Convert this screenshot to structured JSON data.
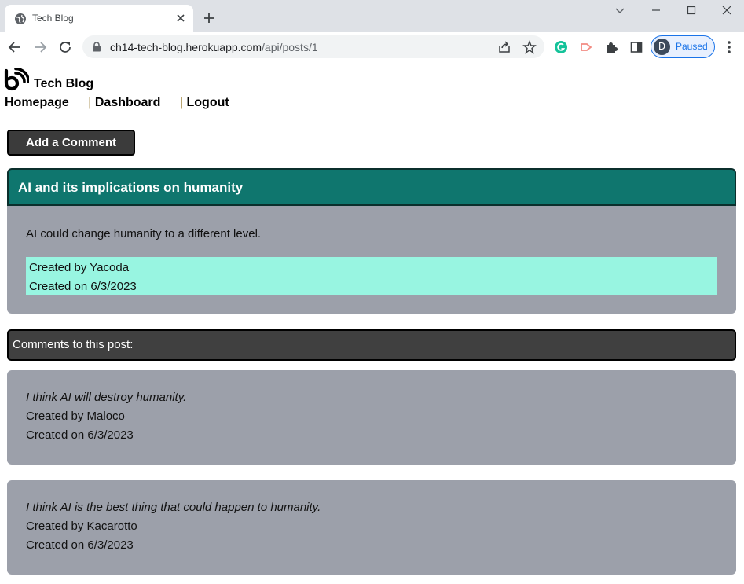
{
  "browser": {
    "tab_title": "Tech Blog",
    "url_host": "ch14-tech-blog.herokuapp.com",
    "url_path": "/api/posts/1",
    "profile_initial": "D",
    "profile_status": "Paused",
    "accent_color": "#1a73e8",
    "icons": [
      "globe-icon",
      "close-icon",
      "plus-icon",
      "back-icon",
      "forward-icon",
      "reload-icon",
      "lock-icon",
      "share-icon",
      "star-icon",
      "grammarly-icon",
      "extension-arrow-icon",
      "puzzle-icon",
      "side-panel-icon",
      "kebab-menu-icon"
    ]
  },
  "site": {
    "title": "Tech Blog",
    "logo_icon": "blog-feed-logo-icon",
    "nav": {
      "homepage": "Homepage",
      "dashboard": "Dashboard",
      "logout": "Logout",
      "separator": "|"
    },
    "add_comment_label": "Add a Comment"
  },
  "post": {
    "title": "AI and its implications on humanity",
    "body": "AI could change humanity to a different level.",
    "created_by": "Created by Yacoda",
    "created_on": "Created on 6/3/2023",
    "header_color": "#0f766e",
    "meta_color": "#98f5e1"
  },
  "comments": {
    "header": "Comments to this post:",
    "items": [
      {
        "text": "I think AI will destroy humanity.",
        "created_by": "Created by Maloco",
        "created_on": "Created on 6/3/2023"
      },
      {
        "text": "I think AI is the best thing that could happen to humanity.",
        "created_by": "Created by Kacarotto",
        "created_on": "Created on 6/3/2023"
      }
    ]
  }
}
